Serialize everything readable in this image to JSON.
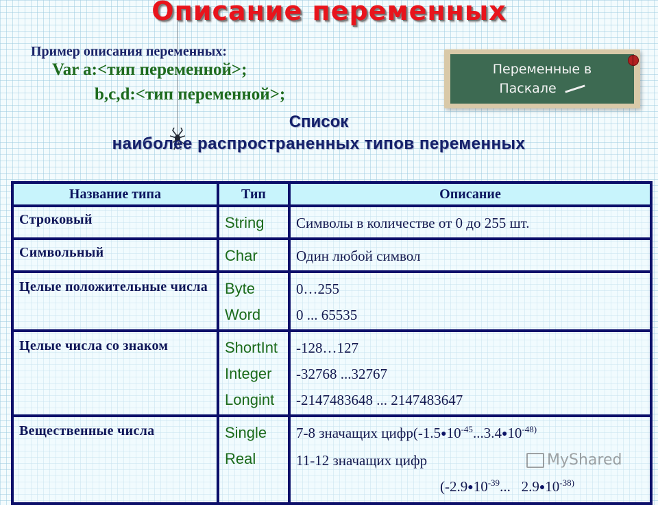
{
  "title": "Описание переменных",
  "example": {
    "label": "Пример описания переменных:",
    "lines": [
      "Var a:<тип переменной>;",
      "b,c,d:<тип переменной>;"
    ]
  },
  "board": {
    "line1": "Переменные в",
    "line2": "Паскале"
  },
  "list_title": {
    "line1": "Список",
    "line2": "наиболее распространенных типов переменных"
  },
  "table": {
    "headers": [
      "Название типа",
      "Тип",
      "Описание"
    ],
    "rows": [
      {
        "name": "Строковый",
        "types": [
          "String"
        ],
        "desc": [
          "Символы в количестве от 0 до 255 шт."
        ]
      },
      {
        "name": "Символьный",
        "types": [
          "Char"
        ],
        "desc": [
          "Один любой символ"
        ]
      },
      {
        "name": "Целые положительные числа",
        "types": [
          "Byte",
          "Word"
        ],
        "desc": [
          "0…255",
          "0 ... 65535"
        ]
      },
      {
        "name": "Целые числа со знаком",
        "types": [
          "ShortInt",
          "Integer",
          "Longint"
        ],
        "desc": [
          "-128…127",
          "-32768 ...32767",
          "-2147483648  ... 2147483647"
        ]
      },
      {
        "name": "Вещественные числа",
        "types": [
          "Single",
          "Real"
        ],
        "desc_single": {
          "prefix": "7-8 значащих цифр(-1.5",
          "exp1": "-45",
          "mid": "...3.4",
          "exp2": "-48)"
        },
        "desc_real": {
          "line1": "11-12 значащих цифр",
          "prefix": "(-2.9",
          "exp1": "-39",
          "mid": "...   2.9",
          "exp2": "-38)"
        },
        "base": "10"
      }
    ]
  },
  "watermark": "MyShared"
}
